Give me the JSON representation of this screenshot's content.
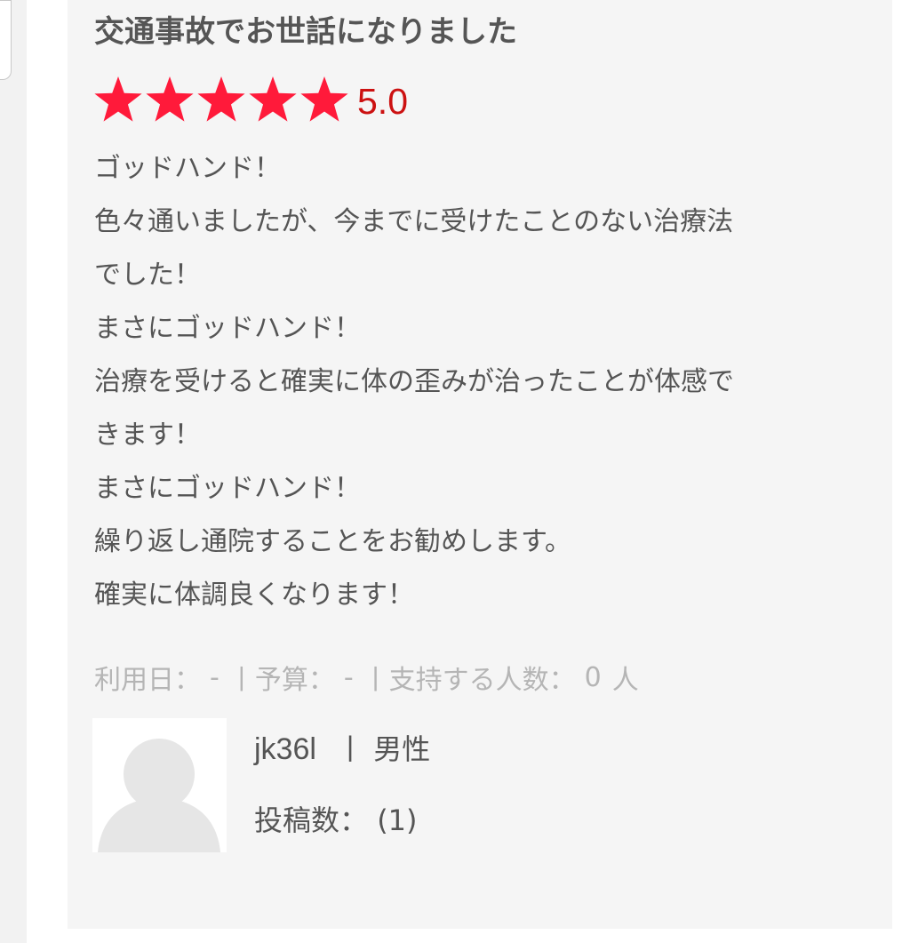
{
  "review": {
    "title": "交通事故でお世話になりました",
    "rating": 5,
    "rating_max": 5,
    "rating_label": "5.0",
    "star_color": "#ff1a3a",
    "rating_text_color": "#cc1111",
    "body_lines": [
      "ゴッドハンド！",
      "色々通いましたが、今までに受けたことのない治療法",
      "でした！",
      "まさにゴッドハンド！",
      "治療を受けると確実に体の歪みが治ったことが体感で",
      "きます！",
      "まさにゴッドハンド！",
      "繰り返し通院することをお勧めします。",
      "確実に体調良くなります！"
    ],
    "meta": {
      "date_label": "利用日：",
      "date_value": "-",
      "separator": "丨",
      "budget_label": "予算：",
      "budget_value": "-",
      "supporters_label": "支持する人数：",
      "supporters_value": "0",
      "supporters_unit": "人"
    },
    "user": {
      "avatar_icon": "default-user-avatar-icon",
      "name": "jk36l",
      "separator": "丨",
      "gender": "男性",
      "post_count_label": "投稿数：",
      "post_count_value": "(1)"
    }
  }
}
